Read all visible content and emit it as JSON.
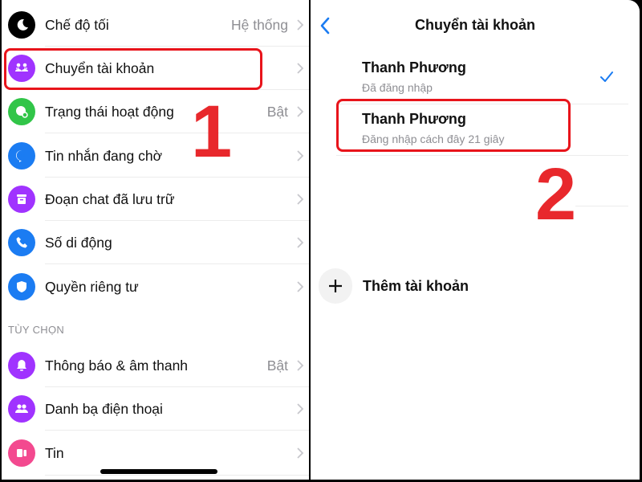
{
  "left_panel": {
    "items": [
      {
        "label": "Chế độ tối",
        "value": "Hệ thống",
        "icon": "moon-icon",
        "color": "#000000"
      },
      {
        "label": "Chuyển tài khoản",
        "value": "",
        "icon": "switch-account-icon",
        "color": "#a033ff"
      },
      {
        "label": "Trạng thái hoạt động",
        "value": "Bật",
        "icon": "active-status-icon",
        "color": "#31c548"
      },
      {
        "label": "Tin nhắn đang chờ",
        "value": "",
        "icon": "message-bubble-icon",
        "color": "#1b7cf2"
      },
      {
        "label": "Đoạn chat đã lưu trữ",
        "value": "",
        "icon": "archive-box-icon",
        "color": "#a033ff"
      },
      {
        "label": "Số di động",
        "value": "",
        "icon": "phone-icon",
        "color": "#1b7cf2"
      },
      {
        "label": "Quyền riêng tư",
        "value": "",
        "icon": "shield-icon",
        "color": "#1b7cf2"
      }
    ],
    "section_label": "TÙY CHỌN",
    "options": [
      {
        "label": "Thông báo & âm thanh",
        "value": "Bật",
        "icon": "bell-icon",
        "color": "#a033ff"
      },
      {
        "label": "Danh bạ điện thoại",
        "value": "",
        "icon": "contacts-icon",
        "color": "#a033ff"
      },
      {
        "label": "Tin",
        "value": "",
        "icon": "stories-icon",
        "color": "#f3498f"
      }
    ],
    "step_marker": "1"
  },
  "right_panel": {
    "title": "Chuyển tài khoản",
    "accounts": [
      {
        "name": "Thanh Phương",
        "status": "Đã đăng nhập",
        "selected": true
      },
      {
        "name": "Thanh Phương",
        "status": "Đăng nhập cách đây 21 giây",
        "selected": false
      }
    ],
    "add_account_label": "Thêm tài khoản",
    "step_marker": "2"
  },
  "colors": {
    "accent_blue": "#1b7cf2",
    "annotation_red": "#e8141b"
  }
}
